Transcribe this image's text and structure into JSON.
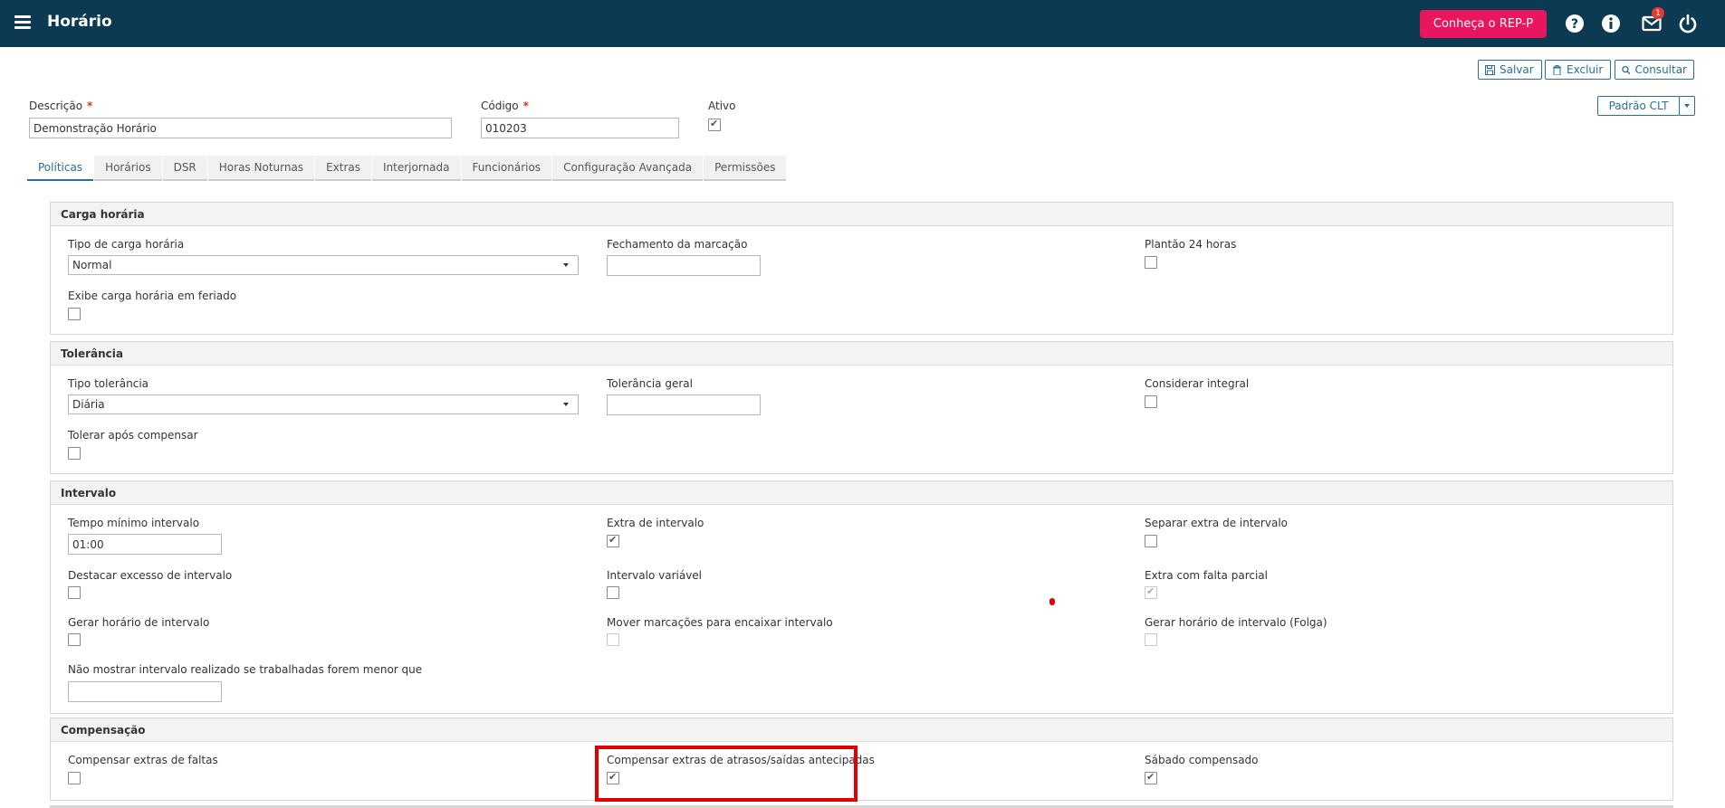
{
  "header": {
    "title": "Horário",
    "rep_button": "Conheça o REP-P",
    "mail_badge": "1"
  },
  "toolbar": {
    "save_label": "Salvar",
    "delete_label": "Excluir",
    "search_label": "Consultar",
    "clt_label": "Padrão CLT"
  },
  "form": {
    "descricao_label": "Descrição",
    "descricao_value": "Demonstração Horário",
    "codigo_label": "Código",
    "codigo_value": "010203",
    "ativo_label": "Ativo",
    "required_mark": "*"
  },
  "tabs": [
    {
      "label": "Políticas",
      "active": true
    },
    {
      "label": "Horários"
    },
    {
      "label": "DSR"
    },
    {
      "label": "Horas Noturnas"
    },
    {
      "label": "Extras"
    },
    {
      "label": "Interjornada"
    },
    {
      "label": "Funcionários"
    },
    {
      "label": "Configuração Avançada"
    },
    {
      "label": "Permissões"
    }
  ],
  "carga": {
    "title": "Carga horária",
    "tipo_label": "Tipo de carga horária",
    "tipo_value": "Normal",
    "fechamento_label": "Fechamento da marcação",
    "fechamento_value": "",
    "plantao_label": "Plantão 24 horas",
    "feriado_label": "Exibe carga horária em feriado"
  },
  "tolerancia": {
    "title": "Tolerância",
    "tipo_label": "Tipo tolerância",
    "tipo_value": "Diária",
    "geral_label": "Tolerância geral",
    "geral_value": "",
    "integral_label": "Considerar integral",
    "apos_label": "Tolerar após compensar"
  },
  "intervalo": {
    "title": "Intervalo",
    "tempo_label": "Tempo mínimo intervalo",
    "tempo_value": "01:00",
    "extra_label": "Extra de intervalo",
    "separar_label": "Separar extra de intervalo",
    "destacar_label": "Destacar excesso de intervalo",
    "variavel_label": "Intervalo variável",
    "falta_label": "Extra com falta parcial",
    "gerar_label": "Gerar horário de intervalo",
    "mover_label": "Mover marcações para encaixar intervalo",
    "gerar_folga_label": "Gerar horário de intervalo (Folga)",
    "nao_mostrar_label": "Não mostrar intervalo realizado se trabalhadas forem menor que",
    "nao_mostrar_value": ""
  },
  "compensacao": {
    "title": "Compensação",
    "faltas_label": "Compensar extras de faltas",
    "atrasos_label": "Compensar extras de atrasos/saídas antecipadas",
    "sabado_label": "Sábado compensado"
  }
}
